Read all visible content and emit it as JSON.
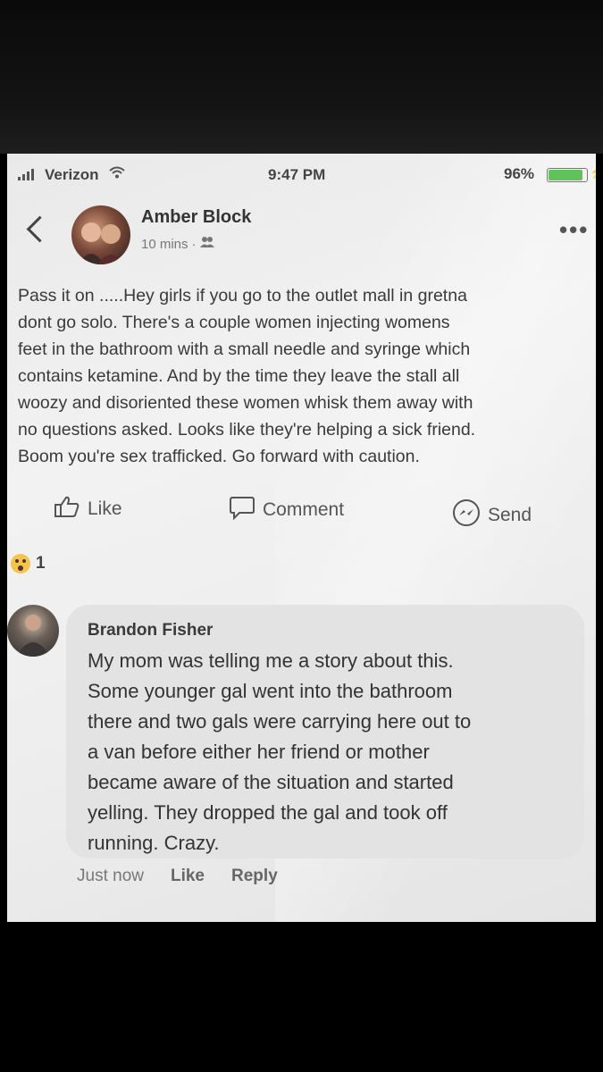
{
  "status_bar": {
    "carrier": "Verizon",
    "time": "9:47 PM",
    "battery": "96%",
    "battery_level": 0.96
  },
  "post": {
    "author": "Amber Block",
    "time": "10 mins",
    "separator": "·",
    "audience_icon": "friends-icon",
    "lines": [
      "Pass it on .....Hey girls if you go to the outlet mall in gretna",
      "dont go solo. There's a couple women injecting womens",
      "feet in the bathroom with a small needle and syringe which",
      "contains ketamine. And by the time they leave the stall all",
      "woozy and disoriented these women whisk them away with",
      "no questions asked. Looks like they're helping a sick friend.",
      "Boom you're sex trafficked. Go forward with caution."
    ],
    "actions": {
      "like": "Like",
      "comment": "Comment",
      "send": "Send"
    },
    "reaction_count": "1"
  },
  "comment": {
    "author": "Brandon Fisher",
    "lines": [
      "My mom was telling me a story about this.",
      "Some younger gal went into the bathroom",
      "there and two gals were carrying here out to",
      "a van before either her friend or mother",
      "became aware of the situation and started",
      "yelling. They dropped the gal and took off",
      "running. Crazy."
    ],
    "time": "Just now",
    "like": "Like",
    "reply": "Reply"
  }
}
